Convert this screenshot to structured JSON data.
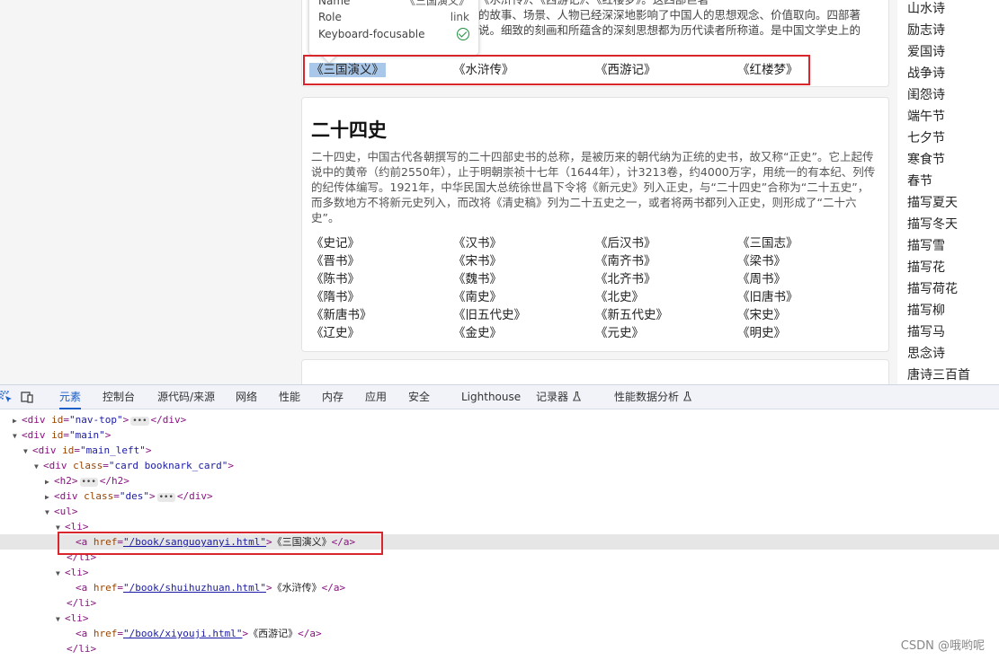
{
  "card1": {
    "desc_line1": "《水浒传》、《西游记》、《红楼梦》。这四部巨著",
    "desc_line2": "的故事、场景、人物已经深深地影响了中国人的思想观念、价值取向。四部著",
    "desc_line3": "说。细致的刻画和所蕴含的深刻思想都为历代读者所称道。是中国文学史上的",
    "books": [
      "《三国演义》",
      "《水浒传》",
      "《西游记》",
      "《红楼梦》"
    ]
  },
  "tooltip": {
    "name_key": "Name",
    "name_val": "《三国演义》",
    "role_key": "Role",
    "role_val": "link",
    "focus_key": "Keyboard-focusable"
  },
  "card2": {
    "title": "二十四史",
    "desc": "二十四史，中国古代各朝撰写的二十四部史书的总称，是被历来的朝代纳为正统的史书，故又称“正史”。它上起传说中的黄帝（约前2550年），止于明朝崇祯十七年（1644年），计3213卷，约4000万字，用统一的有本纪、列传的纪传体编写。1921年，中华民国大总统徐世昌下令将《新元史》列入正史，与“二十四史”合称为“二十五史”，而多数地方不将新元史列入，而改将《清史稿》列为二十五史之一，或者将两书都列入正史，则形成了“二十六史”。",
    "books": [
      "《史记》",
      "《汉书》",
      "《后汉书》",
      "《三国志》",
      "《晋书》",
      "《宋书》",
      "《南齐书》",
      "《梁书》",
      "《陈书》",
      "《魏书》",
      "《北齐书》",
      "《周书》",
      "《隋书》",
      "《南史》",
      "《北史》",
      "《旧唐书》",
      "《新唐书》",
      "《旧五代史》",
      "《新五代史》",
      "《宋史》",
      "《辽史》",
      "《金史》",
      "《元史》",
      "《明史》"
    ]
  },
  "sidebar": {
    "items": [
      "山水诗",
      "励志诗",
      "爱国诗",
      "战争诗",
      "闺怨诗",
      "端午节",
      "七夕节",
      "寒食节",
      "春节",
      "描写夏天",
      "描写冬天",
      "描写雪",
      "描写花",
      "描写荷花",
      "描写柳",
      "描写马",
      "思念诗",
      "唐诗三百首"
    ]
  },
  "devtools": {
    "tabs": [
      "元素",
      "控制台",
      "源代码/来源",
      "网络",
      "性能",
      "内存",
      "应用",
      "安全",
      "Lighthouse",
      "记录器",
      "性能数据分析"
    ],
    "dom": {
      "l1_tag": "<div ",
      "l1_attr": "id",
      "l1_val": "\"nav-top\"",
      "l1_close": "</div>",
      "l2_attr": "id",
      "l2_val": "\"main\"",
      "l3_attr": "id",
      "l3_val": "\"main_left\"",
      "l4_attr": "class",
      "l4_val": "\"card booknark_card\"",
      "l5_open": "<h2>",
      "l5_close": "</h2>",
      "l6_attr": "class",
      "l6_val": "\"des\"",
      "l6_close": "</div>",
      "l7": "<ul>",
      "l8": "<li>",
      "l9_href": "\"/book/sanguoyanyi.html\"",
      "l9_text": "《三国演义》",
      "l10": "</li>",
      "l11": "<li>",
      "l12_href": "\"/book/shuihuzhuan.html\"",
      "l12_text": "《水浒传》",
      "l13": "</li>",
      "l14": "<li>",
      "l15_href": "\"/book/xiyouji.html\"",
      "l15_text": "《西游记》",
      "l16": "</li>"
    }
  },
  "watermark": "CSDN @哦哟呢"
}
